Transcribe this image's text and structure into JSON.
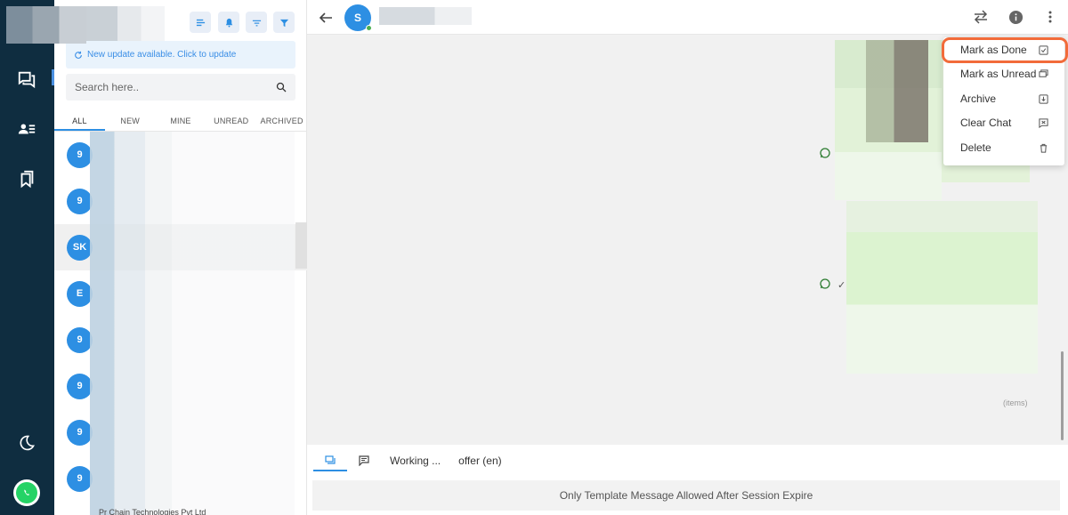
{
  "rail": {
    "icons": [
      "chat-icon",
      "contacts-icon",
      "bookmarks-icon",
      "moon-icon",
      "whatsapp-icon"
    ]
  },
  "list": {
    "toolbar_icons": [
      "sort-icon",
      "bell-icon",
      "filter-lines-icon",
      "funnel-icon"
    ],
    "update_banner": "New update available. Click to update",
    "search": {
      "placeholder": "Search here..",
      "value": ""
    },
    "tabs": [
      {
        "label": "ALL",
        "active": true
      },
      {
        "label": "NEW",
        "active": false
      },
      {
        "label": "MINE",
        "active": false
      },
      {
        "label": "UNREAD",
        "active": false
      },
      {
        "label": "ARCHIVED",
        "active": false
      }
    ],
    "conversations": [
      {
        "initials": "9",
        "selected": false
      },
      {
        "initials": "9",
        "selected": false
      },
      {
        "initials": "SK",
        "selected": true
      },
      {
        "initials": "E",
        "selected": false
      },
      {
        "initials": "9",
        "selected": false
      },
      {
        "initials": "9",
        "selected": false
      },
      {
        "initials": "9",
        "selected": false
      },
      {
        "initials": "9",
        "selected": false
      }
    ],
    "bottom_peek_text": "Pr  Chain Technologies Pvt Ltd"
  },
  "chat": {
    "avatar_initial": "S",
    "header_icons": [
      "swap-icon",
      "info-icon",
      "more-vert-icon"
    ],
    "items_label": "(items)",
    "composer": {
      "tab_working": "Working ...",
      "tab_offer": "offer (en)",
      "note": "Only Template Message Allowed After Session Expire"
    }
  },
  "menu": {
    "items": [
      {
        "label": "Mark as Done",
        "icon": "check-box-icon"
      },
      {
        "label": "Mark as Unread",
        "icon": "unread-chat-icon"
      },
      {
        "label": "Archive",
        "icon": "archive-icon"
      },
      {
        "label": "Clear Chat",
        "icon": "clear-chat-icon"
      },
      {
        "label": "Delete",
        "icon": "trash-icon"
      }
    ]
  },
  "colors": {
    "rail_bg": "#0f2d40",
    "accent": "#2d8fe3",
    "highlight": "#f26b3a",
    "whatsapp": "#25d366"
  }
}
